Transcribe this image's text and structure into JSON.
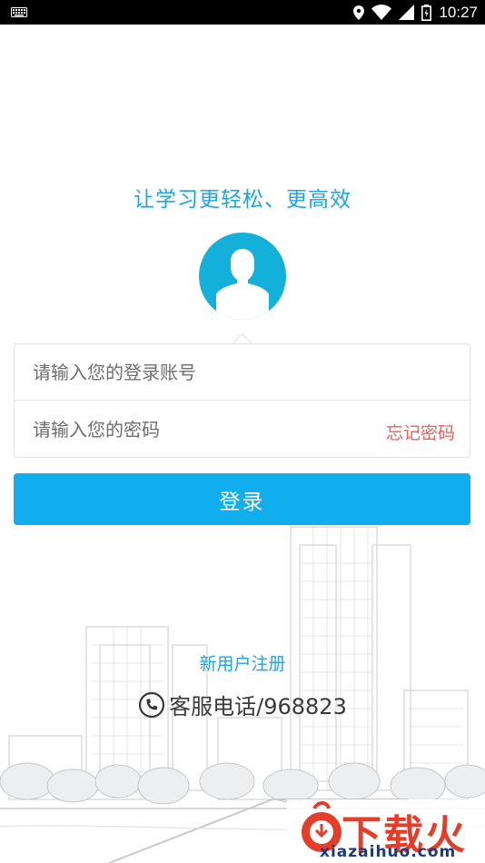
{
  "status_bar": {
    "time": "10:27",
    "icons": [
      "keyboard-icon",
      "location-icon",
      "wifi-icon",
      "signal-icon",
      "battery-icon"
    ]
  },
  "login": {
    "slogan": "让学习更轻松、更高效",
    "avatar_icon": "user-avatar-icon",
    "account_placeholder": "请输入您的登录账号",
    "password_placeholder": "请输入您的密码",
    "forgot_password": "忘记密码",
    "login_button": "登录",
    "register_link": "新用户注册",
    "service_icon": "phone-icon",
    "service_phone": "客服电话/968823"
  },
  "watermark": {
    "logo_text": "下载火",
    "url": "xiazaihuo.com"
  },
  "colors": {
    "accent": "#10aeec",
    "slogan": "#1ba6e0",
    "avatar": "#13b0d9",
    "forgot": "#e8605a"
  }
}
